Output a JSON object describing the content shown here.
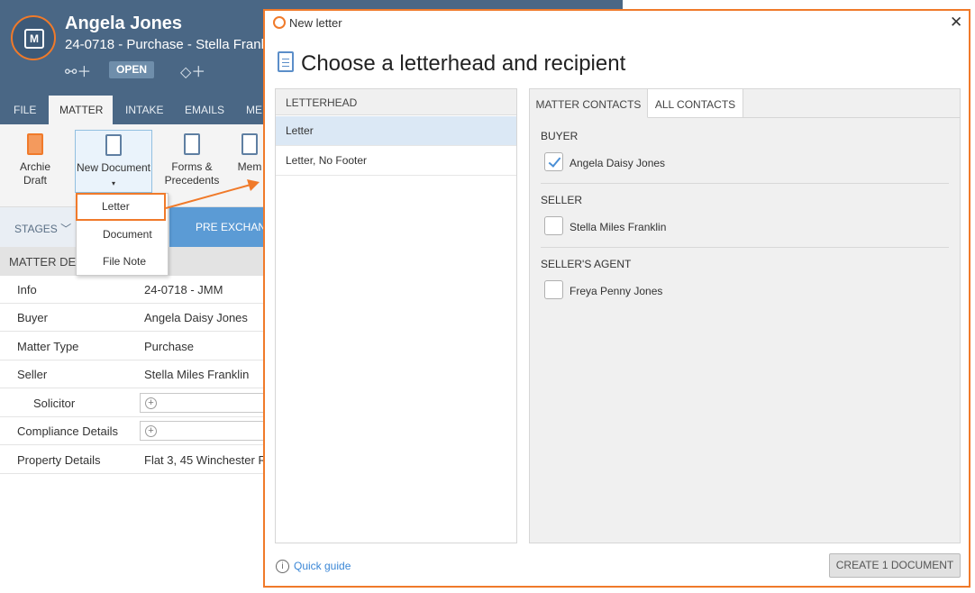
{
  "app": {
    "client_name": "Angela Jones",
    "matter_subtitle": "24-0718 - Purchase - Stella Frankl",
    "status": "OPEN",
    "ribbon_tabs": [
      "FILE",
      "MATTER",
      "INTAKE",
      "EMAILS",
      "ME"
    ],
    "ribbon_buttons": {
      "archie_draft": "Archie Draft",
      "new_document": "New Document",
      "forms_precedents": "Forms & Precedents",
      "mem": "Mem"
    },
    "dropdown": [
      "Letter",
      "Document",
      "File Note"
    ],
    "stages_label": "STAGES",
    "current_stage": "PRE EXCHANG",
    "details_title": "MATTER DET",
    "details": [
      {
        "label": "Info",
        "value": "24-0718 - JMM"
      },
      {
        "label": "Buyer",
        "value": "Angela Daisy Jones"
      },
      {
        "label": "Matter Type",
        "value": "Purchase"
      },
      {
        "label": "Seller",
        "value": "Stella Miles Franklin"
      },
      {
        "label": "Solicitor",
        "value": ""
      },
      {
        "label": "Compliance Details",
        "value": ""
      },
      {
        "label": "Property Details",
        "value": "Flat 3, 45 Winchester R"
      }
    ]
  },
  "dialog": {
    "title": "New letter",
    "heading": "Choose a letterhead and recipient",
    "letterhead_header": "LETTERHEAD",
    "letterheads": [
      "Letter",
      "Letter, No Footer"
    ],
    "contact_tabs": [
      "MATTER CONTACTS",
      "ALL CONTACTS"
    ],
    "groups": [
      {
        "name": "BUYER",
        "contact": "Angela Daisy Jones",
        "checked": true
      },
      {
        "name": "SELLER",
        "contact": "Stella Miles Franklin",
        "checked": false
      },
      {
        "name": "SELLER'S AGENT",
        "contact": "Freya Penny Jones",
        "checked": false
      }
    ],
    "quick_guide": "Quick guide",
    "create_button": "CREATE 1 DOCUMENT"
  },
  "colors": {
    "accent": "#f07a2a",
    "header": "#4a6785",
    "link": "#3b87d6",
    "selection": "#dbe8f5"
  }
}
